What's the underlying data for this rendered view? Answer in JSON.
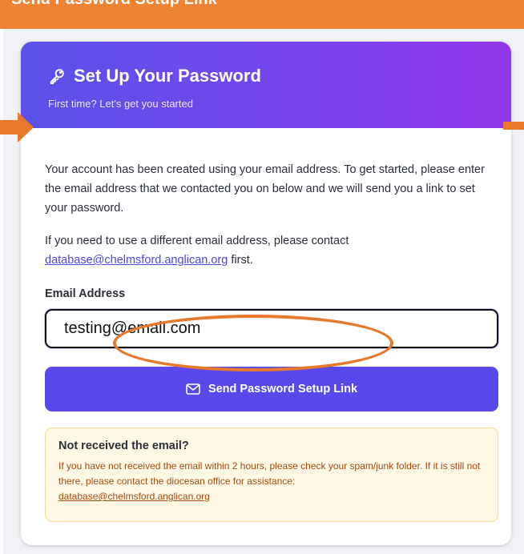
{
  "banner": {
    "text": "“Send Password Setup Link”"
  },
  "header": {
    "title": "Set Up Your Password",
    "subtitle": "First time? Let's get you started",
    "icon": "key-icon"
  },
  "intro": {
    "paragraph": "Your account has been created using your email address. To get started, please enter the email address that we contacted you on below and we will send you a link to set your password.",
    "contact_prefix": "If you need to use a different email address, please contact",
    "contact_email": "database@chelmsford.anglican.org",
    "contact_suffix": "first."
  },
  "form": {
    "email_label": "Email Address",
    "email_value": "testing@email.com",
    "submit_label": "Send Password Setup Link",
    "submit_icon": "mail-icon"
  },
  "notice": {
    "title": "Not received the email?",
    "body": "If you have not received the email within 2 hours, please check your spam/junk folder. If it is still not there, please contact the diocesan office for assistance:",
    "email": "database@chelmsford.anglican.org"
  },
  "colors": {
    "header_gradient_start": "#5b52ea",
    "header_gradient_end": "#9336ea",
    "button": "#5a49ea",
    "annotation": "#e8782c",
    "notice_bg": "#fef8e4",
    "notice_text": "#a54a10"
  }
}
